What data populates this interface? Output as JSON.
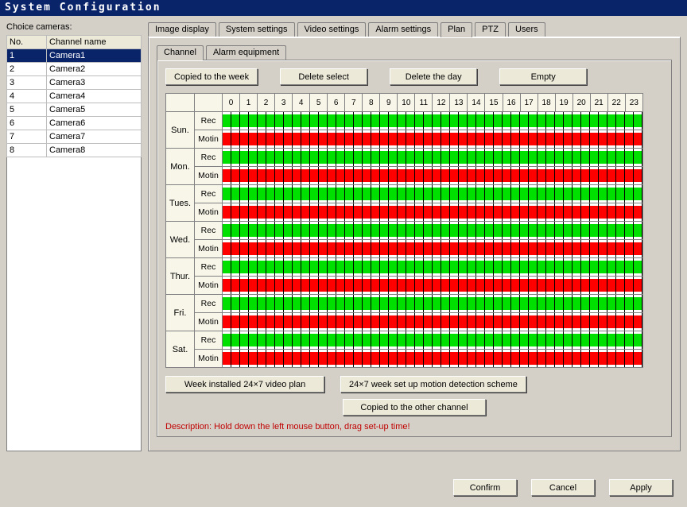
{
  "window": {
    "title": "System Configuration"
  },
  "left": {
    "label": "Choice cameras:",
    "headers": {
      "no": "No.",
      "name": "Channel name"
    },
    "cameras": [
      {
        "no": "1",
        "name": "Camera1",
        "selected": true
      },
      {
        "no": "2",
        "name": "Camera2"
      },
      {
        "no": "3",
        "name": "Camera3"
      },
      {
        "no": "4",
        "name": "Camera4"
      },
      {
        "no": "5",
        "name": "Camera5"
      },
      {
        "no": "6",
        "name": "Camera6"
      },
      {
        "no": "7",
        "name": "Camera7"
      },
      {
        "no": "8",
        "name": "Camera8"
      }
    ]
  },
  "outer_tabs": {
    "items": [
      {
        "label": "Image display"
      },
      {
        "label": "System settings"
      },
      {
        "label": "Video settings"
      },
      {
        "label": "Alarm settings"
      },
      {
        "label": "Plan",
        "active": true
      },
      {
        "label": "PTZ"
      },
      {
        "label": "Users"
      }
    ]
  },
  "inner_tabs": {
    "items": [
      {
        "label": "Channel",
        "active": true
      },
      {
        "label": "Alarm equipment"
      }
    ]
  },
  "buttons": {
    "copied_week": "Copied to the week",
    "delete_select": "Delete select",
    "delete_day": "Delete the day",
    "empty": "Empty",
    "week_plan": "Week installed 24×7 video plan",
    "motion_plan": "24×7 week set up motion detection scheme",
    "copy_channel": "Copied to the other channel"
  },
  "schedule": {
    "hours": [
      "0",
      "1",
      "2",
      "3",
      "4",
      "5",
      "6",
      "7",
      "8",
      "9",
      "10",
      "11",
      "12",
      "13",
      "14",
      "15",
      "16",
      "17",
      "18",
      "19",
      "20",
      "21",
      "22",
      "23"
    ],
    "type_labels": {
      "rec": "Rec",
      "motin": "Motin"
    },
    "days": [
      {
        "label": "Sun."
      },
      {
        "label": "Mon."
      },
      {
        "label": "Tues."
      },
      {
        "label": "Wed."
      },
      {
        "label": "Thur."
      },
      {
        "label": "Fri."
      },
      {
        "label": "Sat."
      }
    ]
  },
  "description": "Description: Hold down the left mouse button, drag set-up time!",
  "footer": {
    "confirm": "Confirm",
    "cancel": "Cancel",
    "apply": "Apply"
  },
  "colors": {
    "rec": "#00e000",
    "motin": "#ff0000",
    "accent": "#0a246a"
  }
}
